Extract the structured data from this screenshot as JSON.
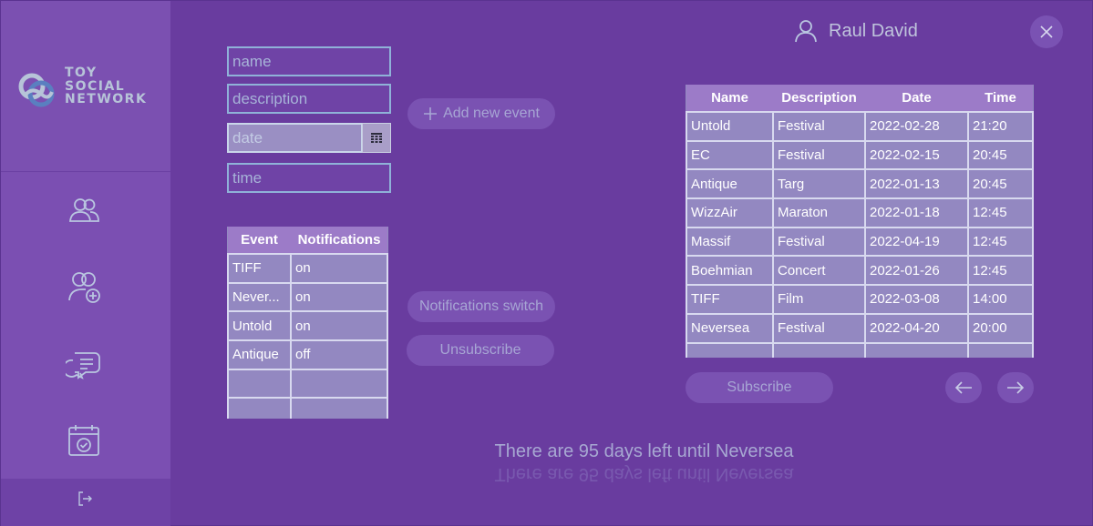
{
  "app": {
    "logo_lines": [
      "TOY",
      "SOCIAL",
      "NETWORK"
    ]
  },
  "user": {
    "name": "Raul David"
  },
  "form": {
    "name_placeholder": "name",
    "description_placeholder": "description",
    "date_placeholder": "date",
    "time_placeholder": "time",
    "add_event_label": "Add new event"
  },
  "my_events": {
    "columns": [
      "Event",
      "Notifications"
    ],
    "rows": [
      [
        "TIFF",
        "on"
      ],
      [
        "Never...",
        "on"
      ],
      [
        "Untold",
        "on"
      ],
      [
        "Antique",
        "off"
      ],
      [
        "",
        ""
      ],
      [
        "",
        ""
      ]
    ]
  },
  "actions": {
    "notifications_switch": "Notifications switch",
    "unsubscribe": "Unsubscribe",
    "subscribe": "Subscribe"
  },
  "all_events": {
    "columns": [
      "Name",
      "Description",
      "Date",
      "Time"
    ],
    "rows": [
      [
        "Untold",
        "Festival",
        "2022-02-28",
        "21:20"
      ],
      [
        "EC",
        "Festival",
        "2022-02-15",
        "20:45"
      ],
      [
        "Antique",
        "Targ",
        "2022-01-13",
        "20:45"
      ],
      [
        "WizzAir",
        "Maraton",
        "2022-01-18",
        "12:45"
      ],
      [
        "Massif",
        "Festival",
        "2022-04-19",
        "12:45"
      ],
      [
        "Boehmian",
        "Concert",
        "2022-01-26",
        "12:45"
      ],
      [
        "TIFF",
        "Film",
        "2022-03-08",
        "14:00"
      ],
      [
        "Neversea",
        "Festival",
        "2022-04-20",
        "20:00"
      ],
      [
        "",
        "",
        "",
        ""
      ]
    ]
  },
  "countdown": "There are 95 days left until Neversea",
  "colors": {
    "background": "#693c9f",
    "sidebar": "#7b4fb2",
    "table_cell": "#9388c1",
    "table_header": "#9c7bc8",
    "field_border": "#8fb2d8"
  }
}
